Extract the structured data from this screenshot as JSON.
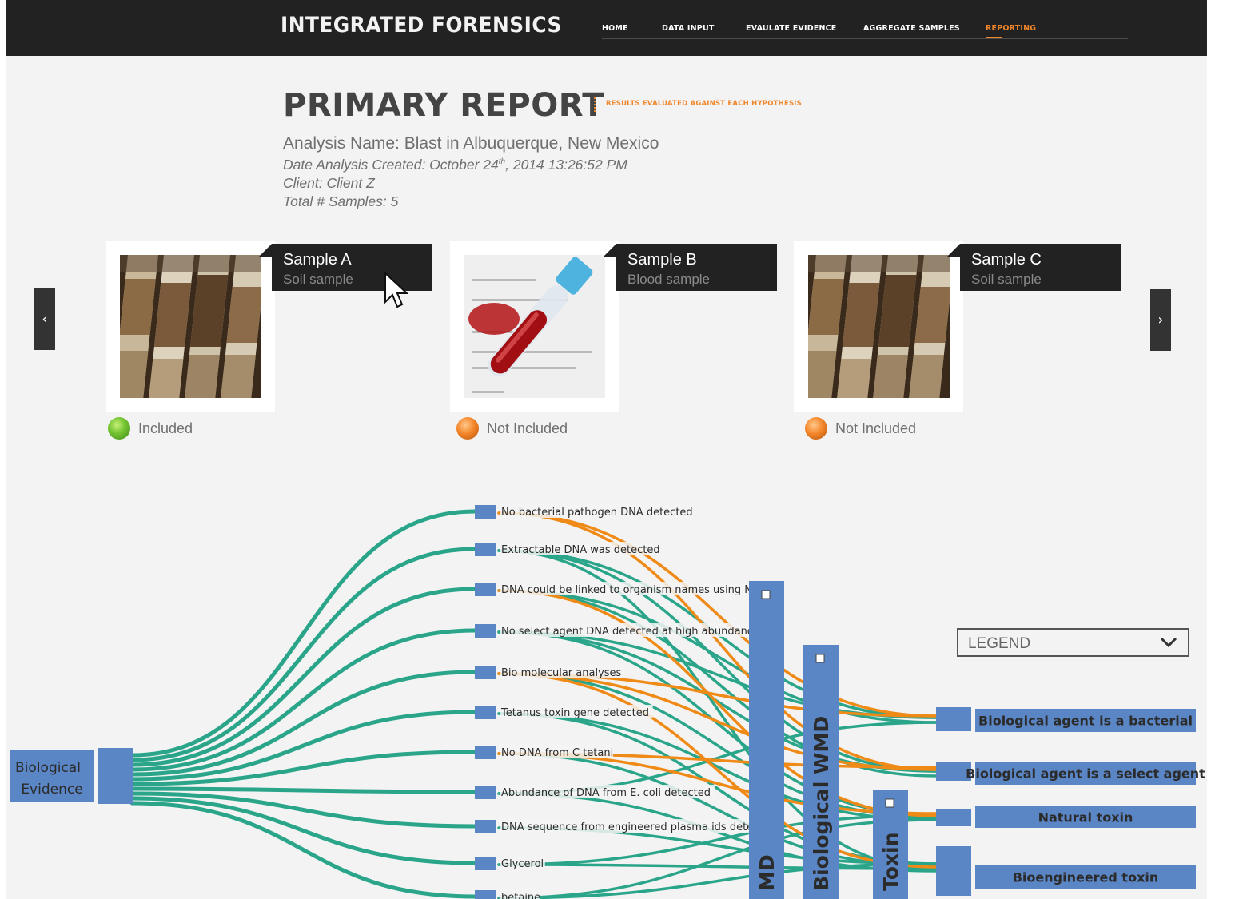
{
  "app": {
    "brand": "INTEGRATED FORENSICS",
    "nav": [
      {
        "label": "HOME",
        "active": false
      },
      {
        "label": "DATA INPUT",
        "active": false
      },
      {
        "label": "EVAULATE EVIDENCE",
        "active": false
      },
      {
        "label": "AGGREGATE SAMPLES",
        "active": false
      },
      {
        "label": "REPORTING",
        "active": true
      }
    ],
    "accent_color": "#f0862a"
  },
  "report": {
    "title": "PRIMARY REPORT",
    "subtitle": "RESULTS EVALUATED AGAINST EACH HYPOTHESIS",
    "analysis_name": "Analysis Name: Blast in Albuquerque, New Mexico",
    "date_prefix": "Date Analysis Created: October 24",
    "date_sup": "th",
    "date_suffix": ", 2014 13:26:52 PM",
    "client": "Client: Client Z",
    "total_samples": "Total # Samples: 5"
  },
  "carousel": {
    "prev_icon": "chevron-left-icon",
    "next_icon": "chevron-right-icon",
    "samples": [
      {
        "name": "Sample A",
        "type": "Soil sample",
        "status": "Included",
        "status_color": "green",
        "image": "soil-jars"
      },
      {
        "name": "Sample B",
        "type": "Blood sample",
        "status": "Not Included",
        "status_color": "orange",
        "image": "blood-tube"
      },
      {
        "name": "Sample C",
        "type": "Soil sample",
        "status": "Not Included",
        "status_color": "orange",
        "image": "soil-jars"
      }
    ]
  },
  "legend": {
    "label": "LEGEND",
    "icon": "chevron-down-icon"
  },
  "flow": {
    "source": {
      "line1": "Biological",
      "line2": "Evidence"
    },
    "evidence": [
      "No bacterial pathogen DNA detected",
      "Extractable DNA was detected",
      "DNA could be linked to organism names using NCBI",
      "No select agent DNA detected at high abundance",
      "Bio molecular analyses",
      "Tetanus toxin gene detected",
      "No DNA from C tetani",
      "Abundance of DNA from E. coli detected",
      "DNA sequence from engineered plasma ids detected",
      "Glycerol",
      "betaine"
    ],
    "groups": [
      "MD",
      "Biological WMD",
      "Toxin"
    ],
    "hypotheses": [
      "Biological agent is a bacterial",
      "Biological agent is a select agent",
      "Natural toxin",
      "Bioengineered toxin"
    ],
    "colors": {
      "support": "#2aa58a",
      "refute": "#f08a17",
      "node": "#5b86c5"
    }
  }
}
